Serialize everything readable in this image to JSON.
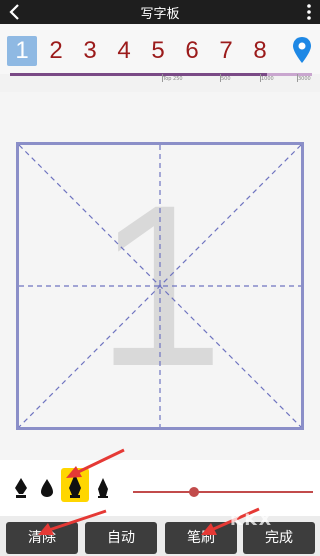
{
  "header": {
    "title": "写字板"
  },
  "numbers": [
    "1",
    "2",
    "3",
    "4",
    "5",
    "6",
    "7",
    "8"
  ],
  "ruler": {
    "ticks": [
      "Top 250",
      "500",
      "1000",
      "3000"
    ],
    "progress": 0.85
  },
  "canvas": {
    "ghost_char": "1"
  },
  "toolbar": {
    "brush_icons": [
      "fountain-pen-icon",
      "ink-drop-icon",
      "brush-pen-icon",
      "calligraphy-brush-icon"
    ],
    "selected_brush": 2,
    "stroke_size": 0.33
  },
  "buttons": {
    "clear": "清除",
    "auto": "自动",
    "brush": "笔刷",
    "done": "完成"
  },
  "watermark": "KKX"
}
